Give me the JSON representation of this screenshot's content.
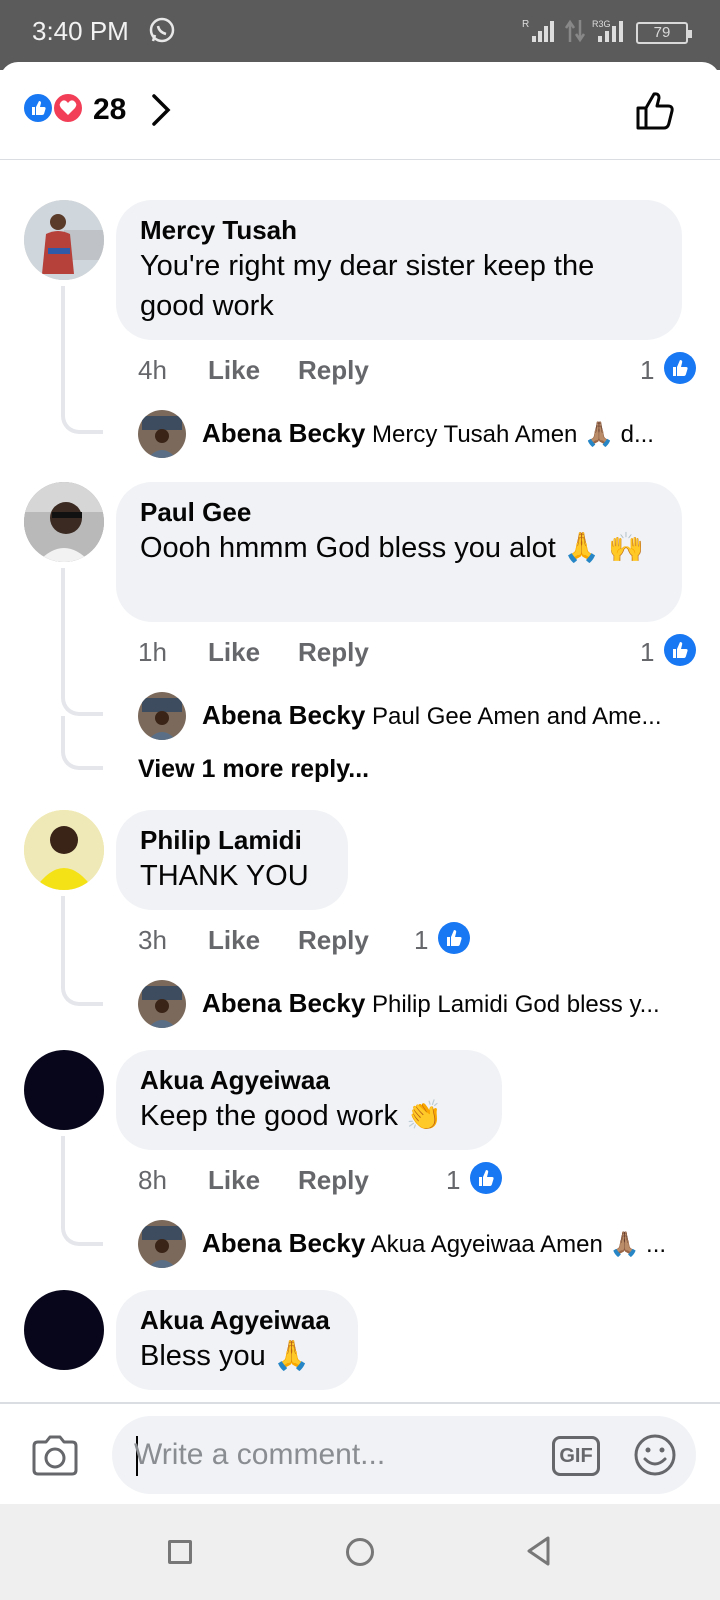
{
  "status_bar": {
    "time": "3:40 PM",
    "battery": "79",
    "sig1_label": "R",
    "sig2_label": "R3G"
  },
  "header": {
    "reaction_count": "28"
  },
  "comments": [
    {
      "author": "Mercy Tusah",
      "text": "You're right my dear sister keep the good work",
      "time": "4h",
      "like_label": "Like",
      "reply_label": "Reply",
      "likes": "1",
      "reply": {
        "author": "Abena Becky",
        "snippet": "Mercy Tusah Amen 🙏🏽 d..."
      }
    },
    {
      "author": "Paul Gee",
      "text": "Oooh hmmm God bless you alot 🙏 🙌",
      "time": "1h",
      "like_label": "Like",
      "reply_label": "Reply",
      "likes": "1",
      "reply": {
        "author": "Abena Becky",
        "snippet": "Paul Gee Amen and Ame..."
      },
      "more_replies": "View 1 more reply..."
    },
    {
      "author": "Philip Lamidi",
      "text": "THANK YOU",
      "time": "3h",
      "like_label": "Like",
      "reply_label": "Reply",
      "likes": "1",
      "reply": {
        "author": "Abena Becky",
        "snippet": "Philip Lamidi God bless y..."
      }
    },
    {
      "author": "Akua Agyeiwaa",
      "text": "Keep the good work 👏",
      "time": "8h",
      "like_label": "Like",
      "reply_label": "Reply",
      "likes": "1",
      "reply": {
        "author": "Abena Becky",
        "snippet": "Akua Agyeiwaa Amen 🙏🏽 ..."
      }
    },
    {
      "author": "Akua Agyeiwaa",
      "text": "Bless you 🙏"
    }
  ],
  "composer": {
    "placeholder": "Write a comment...",
    "gif_label": "GIF"
  },
  "colors": {
    "accent": "#1877f2",
    "love": "#f33e58",
    "bubble": "#f0f2f5",
    "muted": "#65676b"
  },
  "icons": [
    "whatsapp-icon",
    "like-reaction-icon",
    "love-reaction-icon",
    "chevron-right-icon",
    "thumbs-up-icon",
    "camera-icon",
    "gif-icon",
    "emoji-icon",
    "recent-apps-icon",
    "home-icon",
    "back-icon"
  ]
}
